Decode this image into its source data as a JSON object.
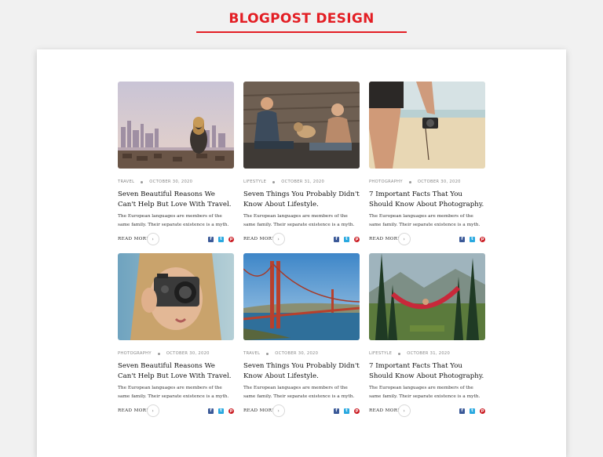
{
  "header": {
    "title": "BLOGPOST DESIGN"
  },
  "posts": [
    {
      "category": "TRAVEL",
      "date": "OCTOBER 30, 2020",
      "title": "Seven Beautiful Reasons We Can't Help But Love With Travel.",
      "excerpt": "The European languages are members of the same family. Their separate existence is a myth.",
      "read_more": "READ MORE",
      "image": "city-overlook-photo"
    },
    {
      "category": "LIFESTYLE",
      "date": "OCTOBER 31, 2020",
      "title": "Seven Things You Probably Didn't Know About Lifestyle.",
      "excerpt": "The European languages are members of the same family. Their separate existence is a myth.",
      "read_more": "READ MORE",
      "image": "friends-with-dog-photo"
    },
    {
      "category": "PHOTOGRAPHY",
      "date": "OCTOBER 30, 2020",
      "title": "7 Important Facts That You Should Know About Photography.",
      "excerpt": "The European languages are members of the same family. Their separate existence is a myth.",
      "read_more": "READ MORE",
      "image": "camera-on-beach-photo"
    },
    {
      "category": "PHOTOGRAPHY",
      "date": "OCTOBER 30, 2020",
      "title": "Seven Beautiful Reasons We Can't Help But Love With Travel.",
      "excerpt": "The European languages are members of the same family. Their separate existence is a myth.",
      "read_more": "READ MORE",
      "image": "woman-with-camera-photo"
    },
    {
      "category": "TRAVEL",
      "date": "OCTOBER 30, 2020",
      "title": "Seven Things You Probably Didn't Know About Lifestyle.",
      "excerpt": "The European languages are members of the same family. Their separate existence is a myth.",
      "read_more": "READ MORE",
      "image": "golden-gate-bridge-photo"
    },
    {
      "category": "LIFESTYLE",
      "date": "OCTOBER 31, 2020",
      "title": "7 Important Facts That You Should Know About Photography.",
      "excerpt": "The European languages are members of the same family. Their separate existence is a myth.",
      "read_more": "READ MORE",
      "image": "hammock-forest-photo"
    }
  ],
  "share_icons": {
    "facebook": "f",
    "twitter": "t",
    "pinterest": "p"
  },
  "colors": {
    "accent": "#e31e24",
    "facebook": "#3b5998",
    "twitter": "#2aa9e0",
    "pinterest": "#cb2027"
  }
}
